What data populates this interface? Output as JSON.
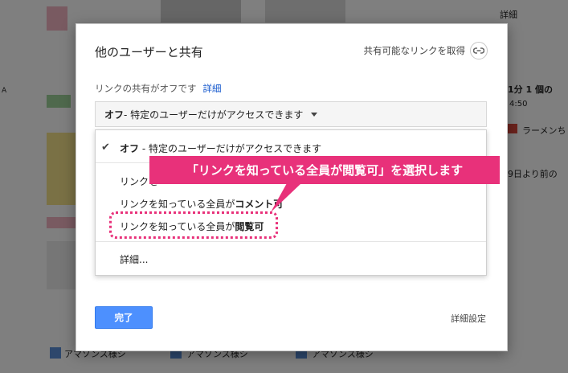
{
  "background": {
    "right_top_label": "詳細",
    "right_snippet_1": "1分 1 個の",
    "right_snippet_2": "4:50",
    "right_snippet_3": "ラーメンち",
    "right_snippet_4": "9日より前の",
    "left_letter": "A",
    "bottom_item_1": "アマゾンス様シ",
    "bottom_item_2": "アマゾンス様シ",
    "bottom_item_3": "アマゾンス様シ"
  },
  "dialog": {
    "title": "他のユーザーと共有",
    "shareable_link_label": "共有可能なリンクを取得",
    "link_status": "リンクの共有がオフです",
    "details_link": "詳細",
    "select": {
      "value_bold": "オフ",
      "value_rest": " - 特定のユーザーだけがアクセスできます"
    },
    "menu": {
      "items": [
        {
          "bold": "オフ",
          "rest": " - 特定のユーザーだけがアクセスできます",
          "checked": true
        },
        {
          "prefix": "リンクを",
          "bold": "",
          "rest": ""
        },
        {
          "prefix": "リンクを知っている全員が",
          "bold": "コメント可",
          "rest": ""
        },
        {
          "prefix": "リンクを知っている全員が",
          "bold": "閲覧可",
          "rest": ""
        }
      ],
      "more": "詳細..."
    },
    "done_button": "完了",
    "advanced_settings": "詳細設定"
  },
  "annotation": {
    "text": "「リンクを知っている全員が閲覧可」を選択します",
    "color": "#e8317a"
  },
  "colors": {
    "primary_button": "#4d90fe",
    "link": "#1155cc"
  }
}
